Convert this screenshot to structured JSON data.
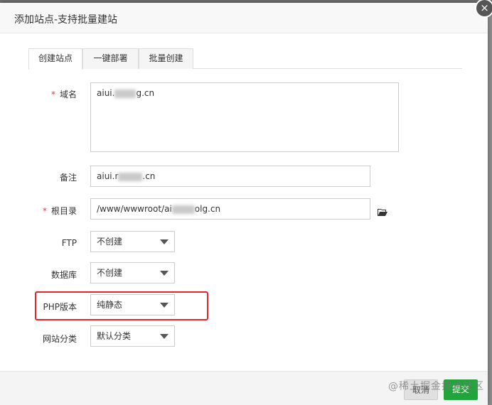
{
  "dialog": {
    "title": "添加站点-支持批量建站",
    "close_symbol": "×"
  },
  "tabs": [
    {
      "label": "创建站点",
      "active": true
    },
    {
      "label": "一键部署",
      "active": false
    },
    {
      "label": "批量创建",
      "active": false
    }
  ],
  "form": {
    "required_mark": "*",
    "domain": {
      "label": "域名",
      "value_prefix": "aiui.",
      "value_suffix": "g.cn"
    },
    "remark": {
      "label": "备注",
      "value_prefix": "aiui.r",
      "value_suffix": ".cn"
    },
    "root": {
      "label": "根目录",
      "value_prefix": "/www/wwwroot/ai",
      "value_suffix": "olg.cn",
      "browse_icon": "folder-open-icon"
    },
    "ftp": {
      "label": "FTP",
      "selected": "不创建"
    },
    "database": {
      "label": "数据库",
      "selected": "不创建"
    },
    "php": {
      "label": "PHP版本",
      "selected": "纯静态"
    },
    "category": {
      "label": "网站分类",
      "selected": "默认分类"
    }
  },
  "footer": {
    "cancel_label": "取消",
    "submit_label": "提交"
  },
  "watermark": "@稀土掘金技术社区",
  "colors": {
    "highlight_border": "#e6262c",
    "submit_bg": "#20a53a",
    "required": "#e33333"
  }
}
